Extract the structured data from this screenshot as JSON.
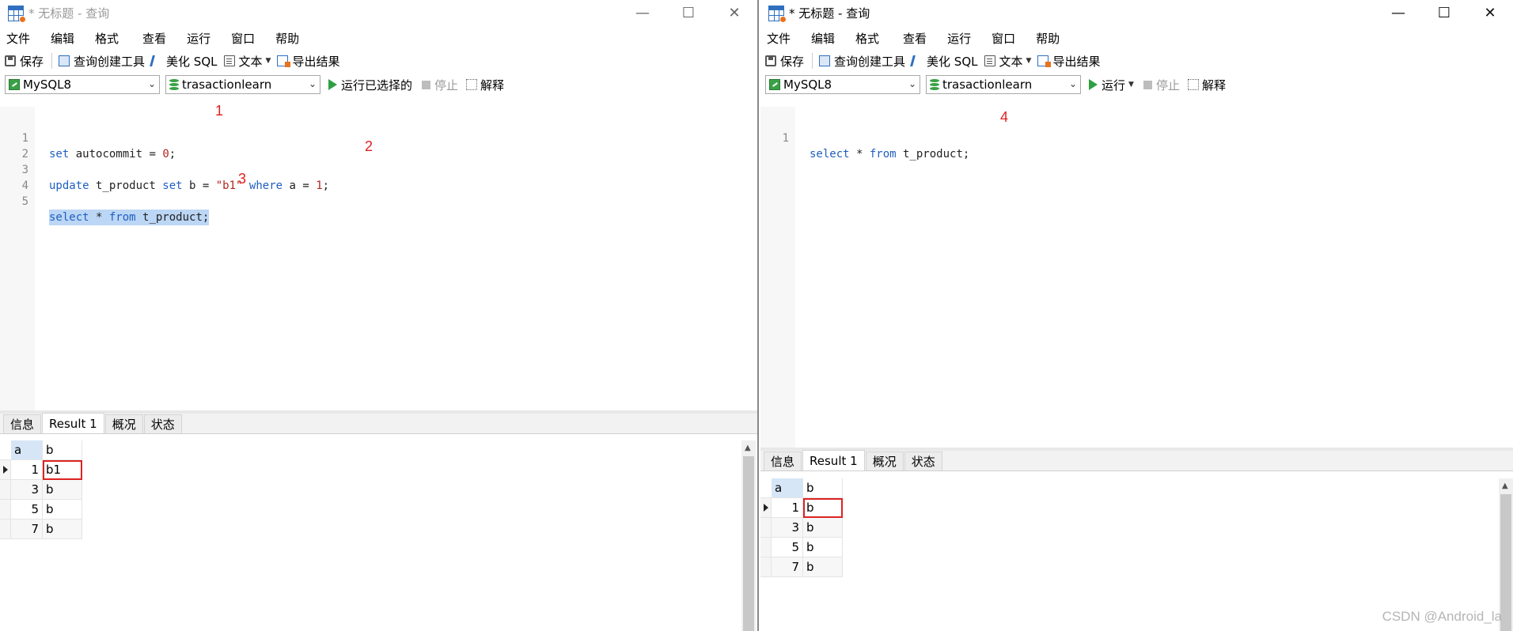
{
  "left_window": {
    "title": "* 无标题 - 查询",
    "window_controls": {
      "minimize": "—",
      "maximize": "☐",
      "close": "✕"
    },
    "menu": [
      "文件",
      "编辑",
      "格式",
      "查看",
      "运行",
      "窗口",
      "帮助"
    ],
    "toolbar": {
      "save": "保存",
      "query_builder": "查询创建工具",
      "beautify": "美化 SQL",
      "text": "文本",
      "export": "导出结果"
    },
    "connection": "MySQL8",
    "database": "trasactionlearn",
    "run_label": "运行已选择的",
    "stop_label": "停止",
    "explain_label": "解释",
    "editor": {
      "line_numbers": [
        "1",
        "2",
        "3",
        "4",
        "5"
      ],
      "line1": {
        "kw1": "set",
        "rest": " autocommit = ",
        "num": "0",
        "end": ";"
      },
      "line3": {
        "kw1": "update",
        "p1": " t_product ",
        "kw2": "set",
        "p2": " b = ",
        "str": "\"b1\"",
        "p3": " ",
        "kw3": "where",
        "p4": " a = ",
        "num": "1",
        "end": ";"
      },
      "line5": {
        "kw1": "select",
        "p1": " * ",
        "kw2": "from",
        "p2": " t_product;"
      }
    },
    "annotations": [
      "1",
      "2",
      "3"
    ],
    "tabs": [
      "信息",
      "Result 1",
      "概况",
      "状态"
    ],
    "active_tab": "Result 1",
    "grid": {
      "columns": [
        "a",
        "b"
      ],
      "rows": [
        [
          "1",
          "b1"
        ],
        [
          "3",
          "b"
        ],
        [
          "5",
          "b"
        ],
        [
          "7",
          "b"
        ]
      ]
    }
  },
  "right_window": {
    "title": "* 无标题 - 查询",
    "window_controls": {
      "minimize": "—",
      "maximize": "☐",
      "close": "✕"
    },
    "menu": [
      "文件",
      "编辑",
      "格式",
      "查看",
      "运行",
      "窗口",
      "帮助"
    ],
    "toolbar": {
      "save": "保存",
      "query_builder": "查询创建工具",
      "beautify": "美化 SQL",
      "text": "文本",
      "export": "导出结果"
    },
    "connection": "MySQL8",
    "database": "trasactionlearn",
    "run_label": "运行",
    "stop_label": "停止",
    "explain_label": "解释",
    "editor": {
      "line_numbers": [
        "1"
      ],
      "line1": {
        "kw1": "select",
        "p1": " * ",
        "kw2": "from",
        "p2": " t_product;"
      }
    },
    "annotations": [
      "4"
    ],
    "tabs": [
      "信息",
      "Result 1",
      "概况",
      "状态"
    ],
    "active_tab": "Result 1",
    "grid": {
      "columns": [
        "a",
        "b"
      ],
      "rows": [
        [
          "1",
          "b"
        ],
        [
          "3",
          "b"
        ],
        [
          "5",
          "b"
        ],
        [
          "7",
          "b"
        ]
      ]
    }
  },
  "watermark": "CSDN @Android_la",
  "colors": {
    "keyword": "#1f5fbf",
    "string": "#b3261e",
    "selection": "#bcd6f5",
    "annotation": "#e02020",
    "run": "#2ea043"
  }
}
